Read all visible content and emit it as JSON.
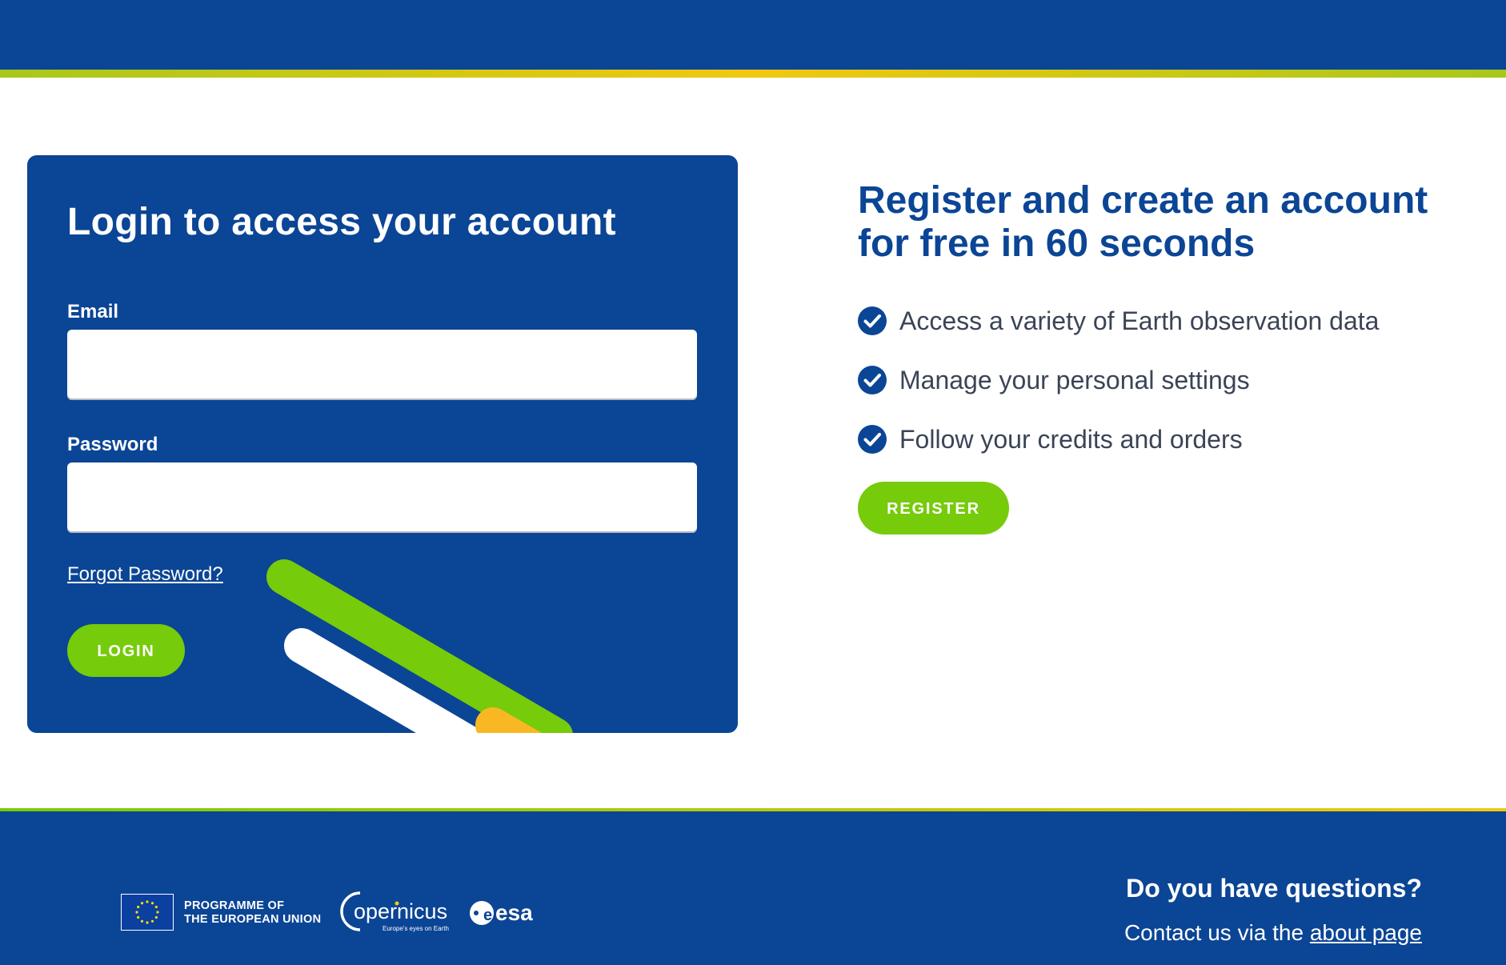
{
  "colors": {
    "brand_blue": "#0b4595",
    "accent_green": "#76cb0a",
    "accent_yellow": "#f2c80f",
    "text_gray": "#3b4456"
  },
  "login": {
    "title": "Login to access your account",
    "email_label": "Email",
    "email_value": "",
    "password_label": "Password",
    "password_value": "",
    "forgot_link": "Forgot Password?",
    "login_button": "LOGIN"
  },
  "register": {
    "title_line1": "Register and create an account",
    "title_line2": "for free in 60 seconds",
    "benefits": [
      {
        "icon": "check-circle-icon",
        "text": "Access a variety of Earth observation data"
      },
      {
        "icon": "check-circle-icon",
        "text": "Manage your personal settings"
      },
      {
        "icon": "check-circle-icon",
        "text": "Follow your credits and orders"
      }
    ],
    "register_button": "REGISTER"
  },
  "footer": {
    "eu_line1": "PROGRAMME OF",
    "eu_line2": "THE EUROPEAN UNION",
    "copernicus_name": "opernicus",
    "copernicus_tagline": "Europe's eyes on Earth",
    "esa_name": "esa",
    "help_title": "Do you have questions?",
    "help_text": "Contact us via the ",
    "help_link": "about page"
  }
}
